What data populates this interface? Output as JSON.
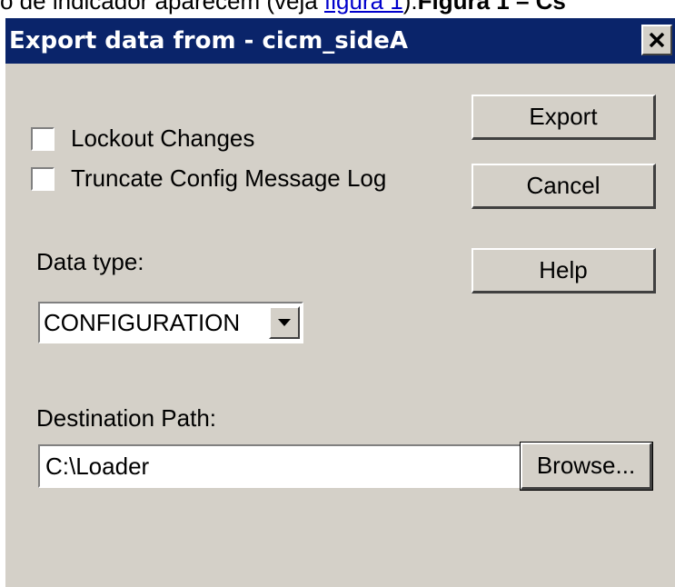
{
  "background_text": {
    "prefix": "o de indicador aparecem (veja ",
    "link": "figura 1",
    "suffix": ").",
    "figure_label": "Figura 1 – Cs"
  },
  "dialog": {
    "title": "Export data from - cicm_sideA",
    "close_icon": "close-icon",
    "buttons": {
      "export": "Export",
      "cancel": "Cancel",
      "help": "Help",
      "browse": "Browse..."
    },
    "checkboxes": [
      {
        "label": "Lockout Changes",
        "checked": false
      },
      {
        "label": "Truncate Config Message Log",
        "checked": false
      }
    ],
    "data_type": {
      "label": "Data type:",
      "selected": "CONFIGURATION"
    },
    "destination": {
      "label": "Destination Path:",
      "value": "C:\\Loader"
    }
  },
  "colors": {
    "title_bar": "#0a246a",
    "dialog_face": "#d4d0c8"
  }
}
